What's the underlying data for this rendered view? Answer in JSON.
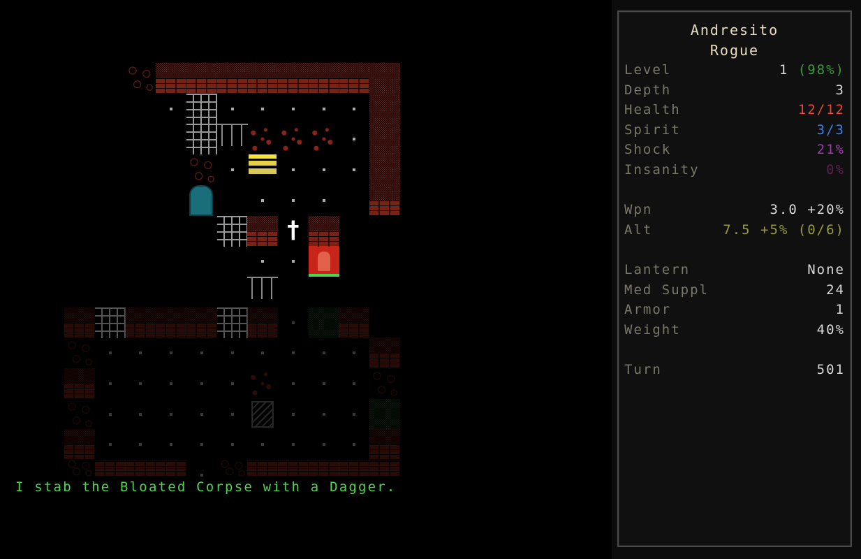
{
  "message": "I stab the Bloated Corpse with a Dagger.",
  "character": {
    "name": "Andresito",
    "class": "Rogue"
  },
  "stats": [
    {
      "label": "Level",
      "value": "1",
      "extra": "(98%)",
      "value_color": "#d8d8d8",
      "extra_color": "#3a9a3a"
    },
    {
      "label": "Depth",
      "value": "3",
      "value_color": "#d8d8d8"
    },
    {
      "label": "Health",
      "value": "12/12",
      "value_color": "#e8453a"
    },
    {
      "label": "Spirit",
      "value": "3/3",
      "value_color": "#3a82e8"
    },
    {
      "label": "Shock",
      "value": "21%",
      "value_color": "#a03ab0"
    },
    {
      "label": "Insanity",
      "value": "0%",
      "value_color": "#5a2050"
    }
  ],
  "weapons": [
    {
      "label": "Wpn",
      "value": "3.0 +20%",
      "value_color": "#d8d8d8"
    },
    {
      "label": "Alt",
      "value": "7.5 +5% (0/6)",
      "value_color": "#9a9a3a"
    }
  ],
  "inventory": [
    {
      "label": "Lantern",
      "value": "None"
    },
    {
      "label": "Med Suppl",
      "value": "24"
    },
    {
      "label": "Armor",
      "value": "1"
    },
    {
      "label": "Weight",
      "value": "40%"
    }
  ],
  "turn": {
    "label": "Turn",
    "value": "501"
  },
  "map": {
    "entities": {
      "player": {
        "name": "Andresito",
        "glyph": "player-rogue"
      },
      "enemy": {
        "name": "Bloated Corpse",
        "health_fraction": 1.0
      }
    },
    "rows": [
      "  RWWWWWWWS",
      "   .#.....S",
      "    #CBBB.S",
      "    R.F...S",
      "    D ... W",
      "     #W@W  ",
      "      ..E  ",
      "      C    ",
      "w#www#w.gw ",
      "r.........w",
      "w.....b...r",
      "r.....M...g",
      "w.........w",
      "rwww.rwwwww"
    ]
  }
}
